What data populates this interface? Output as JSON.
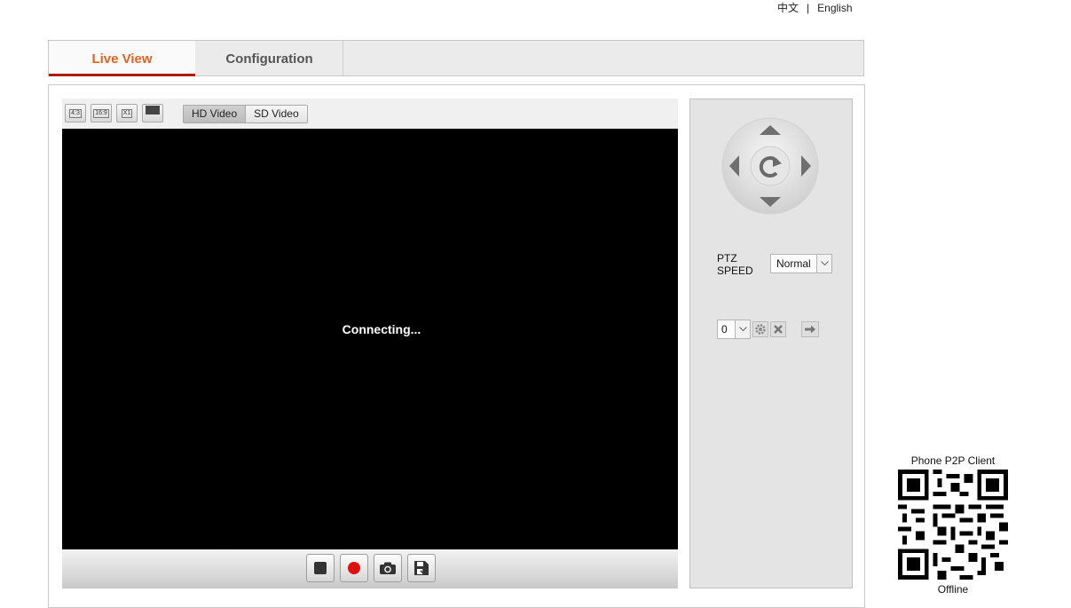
{
  "language": {
    "chinese": "中文",
    "separator": "|",
    "english": "English"
  },
  "tabs": {
    "live_view": "Live View",
    "configuration": "Configuration"
  },
  "player": {
    "aspect_buttons": [
      "4:3",
      "16:9",
      "X1"
    ],
    "stream": {
      "hd": "HD Video",
      "sd": "SD Video"
    },
    "status_text": "Connecting...",
    "controls": [
      "stop-icon",
      "record-icon",
      "camera-icon",
      "save-icon"
    ],
    "colors": {
      "video_bg": "#000000",
      "record": "#e01010"
    }
  },
  "ptz": {
    "speed_label_line1": "PTZ",
    "speed_label_line2": "SPEED",
    "speed_value": "Normal",
    "preset_value": "0"
  },
  "qr": {
    "title": "Phone P2P Client",
    "status": "Offline"
  },
  "accent": {
    "active_tab_text": "#e0621e",
    "active_tab_underline": "#a81d10"
  }
}
